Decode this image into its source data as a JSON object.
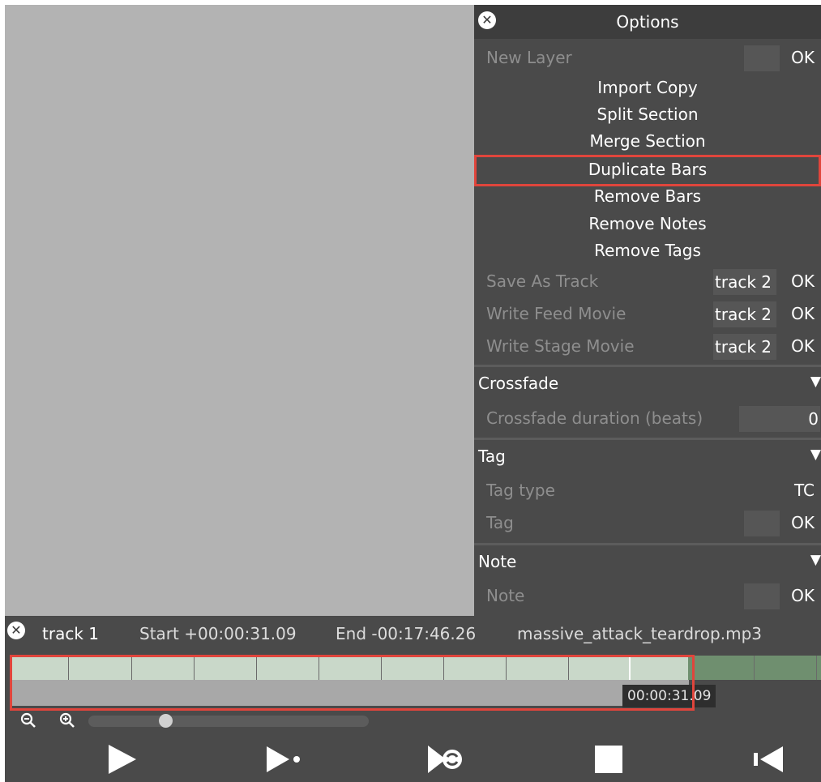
{
  "options": {
    "title": "Options",
    "new_layer": {
      "label": "New Layer",
      "value": "",
      "ok": "OK"
    },
    "actions": [
      "Import Copy",
      "Split Section",
      "Merge Section",
      "Duplicate Bars",
      "Remove Bars",
      "Remove Notes",
      "Remove Tags"
    ],
    "highlighted_action": "Duplicate Bars",
    "save_as_track": {
      "label": "Save As Track",
      "value": "track 2",
      "ok": "OK"
    },
    "write_feed_movie": {
      "label": "Write Feed Movie",
      "value": "track 2",
      "ok": "OK"
    },
    "write_stage_movie": {
      "label": "Write Stage Movie",
      "value": "track 2",
      "ok": "OK"
    },
    "crossfade": {
      "title": "Crossfade",
      "duration_label": "Crossfade duration (beats)",
      "duration_value": "0"
    },
    "tag": {
      "title": "Tag",
      "type_label": "Tag type",
      "type_value": "TC",
      "tag_label": "Tag",
      "tag_value": "",
      "ok": "OK"
    },
    "note": {
      "title": "Note",
      "note_label": "Note",
      "note_value": "",
      "ok": "OK"
    }
  },
  "transport": {
    "track_name": "track 1",
    "start": "Start +00:00:31.09",
    "end": "End -00:17:46.26",
    "filename": "massive_attack_teardrop.mp3",
    "playhead_time": "00:00:31.09",
    "buttons": [
      "play-icon",
      "play-from-icon",
      "loop-icon",
      "stop-icon",
      "skip-to-start-icon"
    ]
  },
  "colors": {
    "panel_bg": "#4a4a4a",
    "canvas_bg": "#b3b3b3",
    "highlight": "#e0453c",
    "timeline_light": "#c9d8c9",
    "timeline_dark": "#6f8f6f"
  }
}
